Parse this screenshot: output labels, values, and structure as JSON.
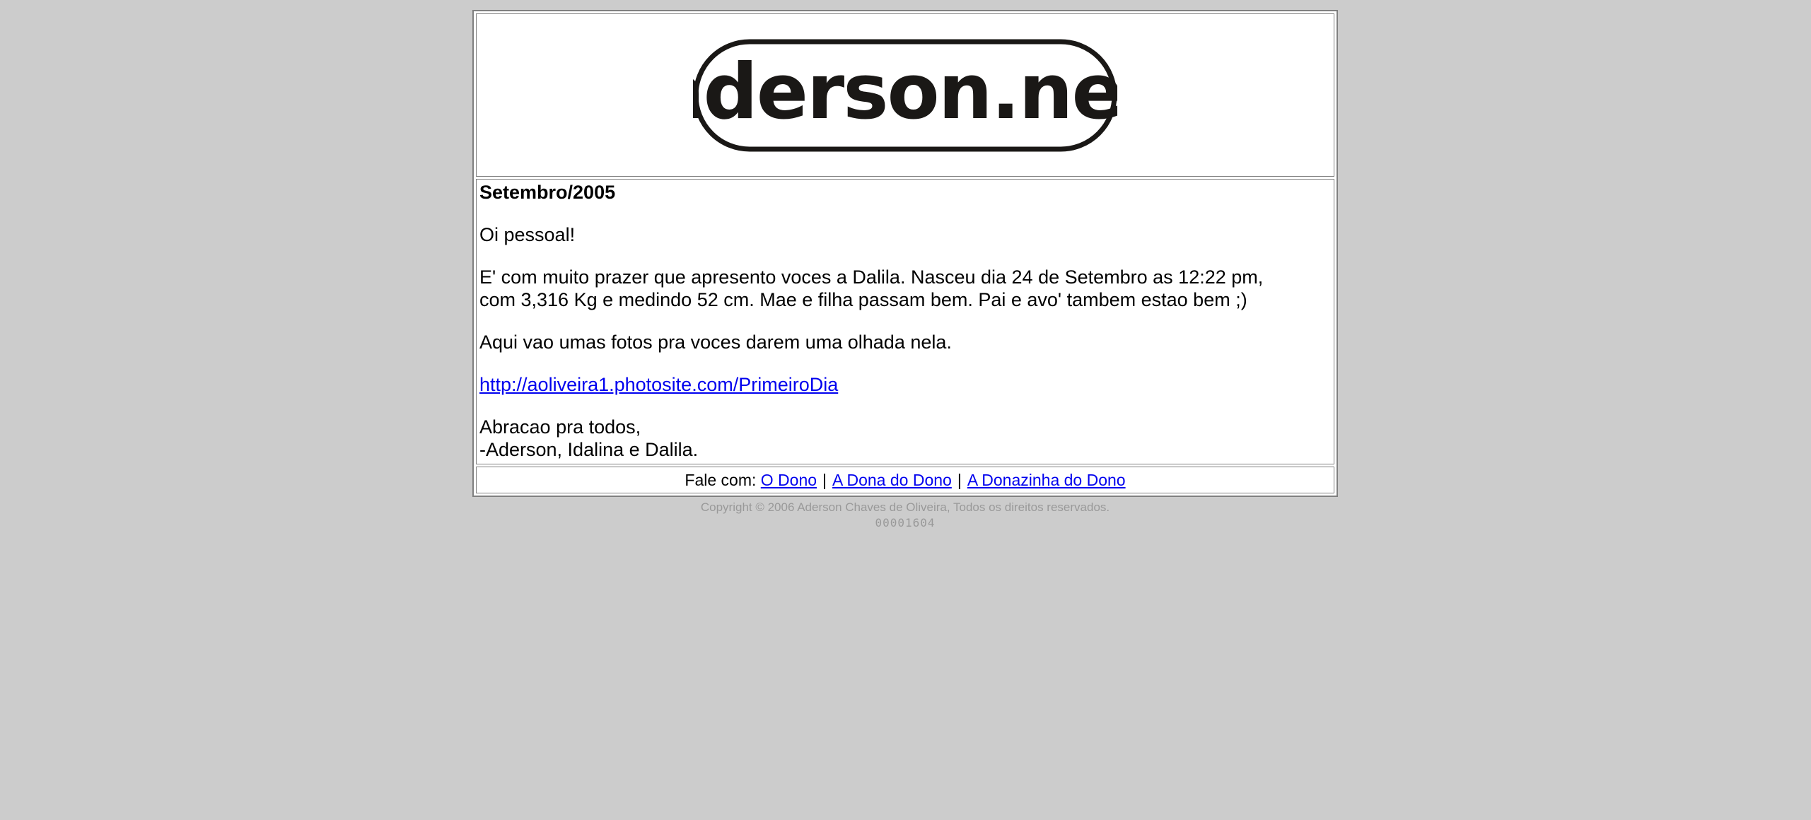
{
  "header": {
    "logo_text": "aderson.net"
  },
  "post": {
    "title": "Setembro/2005",
    "greeting": "Oi pessoal!",
    "paragraph1_line1": "E' com muito prazer que apresento voces a Dalila. Nasceu dia 24 de Setembro as 12:22 pm,",
    "paragraph1_line2": "com 3,316 Kg e medindo 52 cm. Mae e filha passam bem. Pai e avo' tambem estao bem ;)",
    "paragraph2": "Aqui vao umas fotos pra voces darem uma olhada nela.",
    "photo_link": "http://aoliveira1.photosite.com/PrimeiroDia",
    "closing_line1": "Abracao pra todos,",
    "closing_line2": "-Aderson, Idalina e Dalila."
  },
  "footer": {
    "contact_label": "Fale com:",
    "links": [
      "O Dono",
      "A Dona do Dono",
      "A Donazinha do Dono"
    ],
    "separator": "|"
  },
  "copyright": "Copyright © 2006 Aderson Chaves de Oliveira, Todos os direitos reservados.",
  "counter": "00001604"
}
